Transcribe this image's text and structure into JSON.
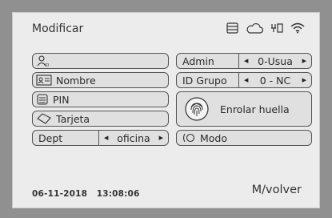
{
  "header": {
    "title": "Modificar",
    "icons": [
      "storage-icon",
      "cloud-icon",
      "usb-icon",
      "wifi-icon"
    ]
  },
  "left_column": {
    "user_id": {
      "value": "",
      "icon": "user-id-icon"
    },
    "name": {
      "label": "Nombre",
      "icon": "id-card-icon"
    },
    "pin": {
      "label": "PIN",
      "icon": "keypad-icon"
    },
    "card": {
      "label": "Tarjeta",
      "icon": "card-icon"
    },
    "dept": {
      "label": "Dept",
      "value": "oficina"
    }
  },
  "right_column": {
    "admin": {
      "label": "Admin",
      "value": "0-Usua"
    },
    "group": {
      "label": "ID Grupo",
      "value": "0 - NC"
    },
    "enroll": {
      "label": "Enrolar huella",
      "icon": "fingerprint-icon"
    },
    "mode": {
      "label": "Modo",
      "icon": "toggle-icon"
    }
  },
  "footer": {
    "datetime": "06-11-2018   13:08:06",
    "back_label": "M/volver"
  }
}
